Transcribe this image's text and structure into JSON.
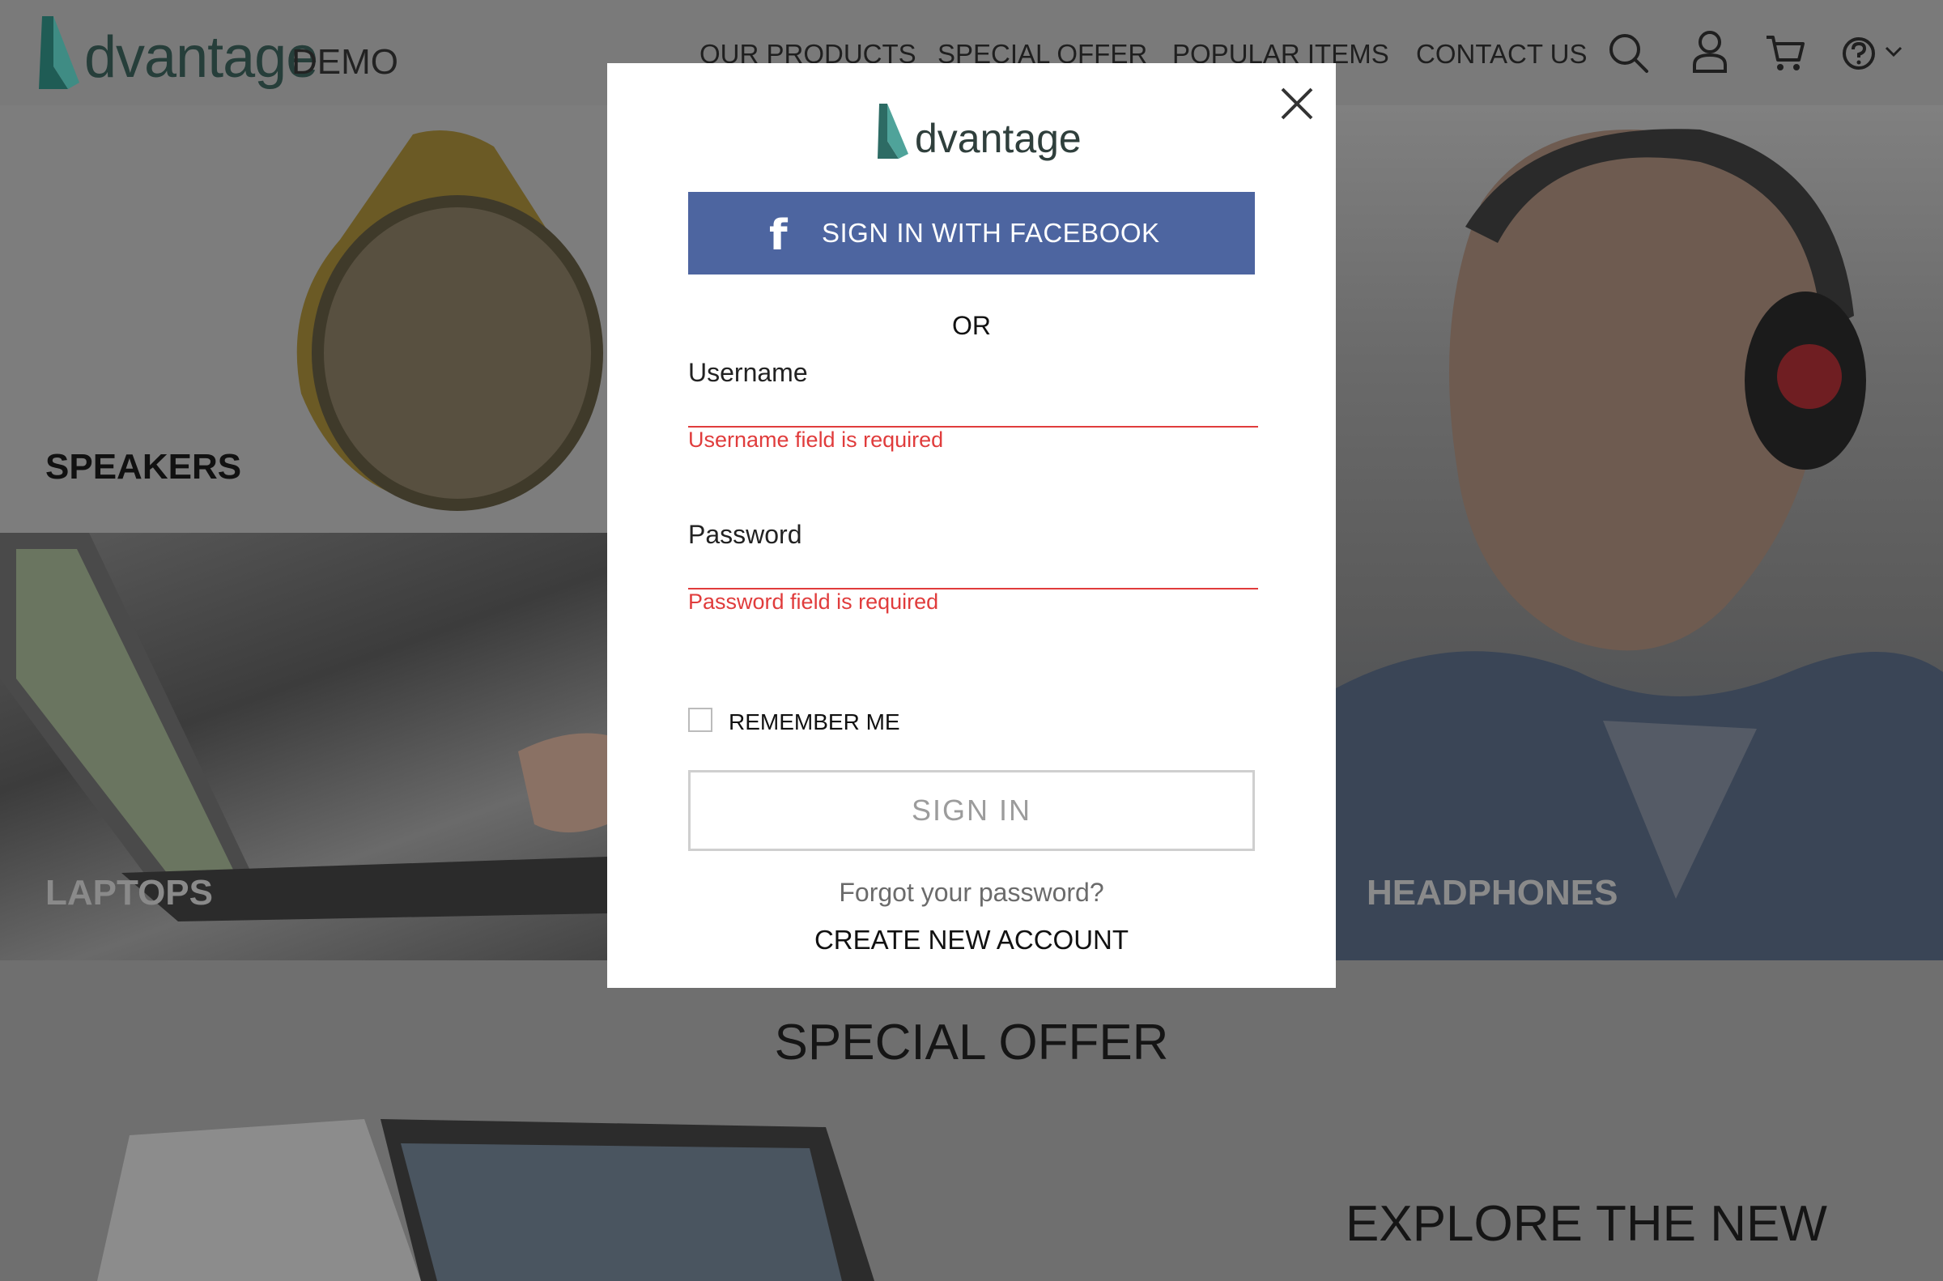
{
  "header": {
    "logo_text": "dvantage",
    "logo_suffix": "DEMO",
    "nav": [
      "OUR PRODUCTS",
      "SPECIAL OFFER",
      "POPULAR ITEMS",
      "CONTACT US"
    ],
    "icons": [
      "search-icon",
      "user-icon",
      "cart-icon",
      "help-icon",
      "chevron-down-icon"
    ]
  },
  "categories": {
    "speakers": "SPEAKERS",
    "laptops": "LAPTOPS",
    "headphones": "HEADPHONES"
  },
  "special_offer": {
    "title": "SPECIAL OFFER",
    "explore": "EXPLORE THE NEW"
  },
  "login_modal": {
    "logo_text": "dvantage",
    "facebook_label": "SIGN IN WITH FACEBOOK",
    "or_text": "OR",
    "username": {
      "label": "Username",
      "value": "",
      "error": "Username field is required"
    },
    "password": {
      "label": "Password",
      "value": "",
      "error": "Password field is required"
    },
    "remember_me": "REMEMBER ME",
    "remember_checked": false,
    "signin_label": "SIGN IN",
    "forgot_label": "Forgot your password?",
    "create_account_label": "CREATE NEW ACCOUNT"
  },
  "colors": {
    "brand_teal": "#3f8c84",
    "facebook_blue": "#4d65a0",
    "error_red": "#e03c3c",
    "overlay_gray": "#7a7a7a"
  }
}
